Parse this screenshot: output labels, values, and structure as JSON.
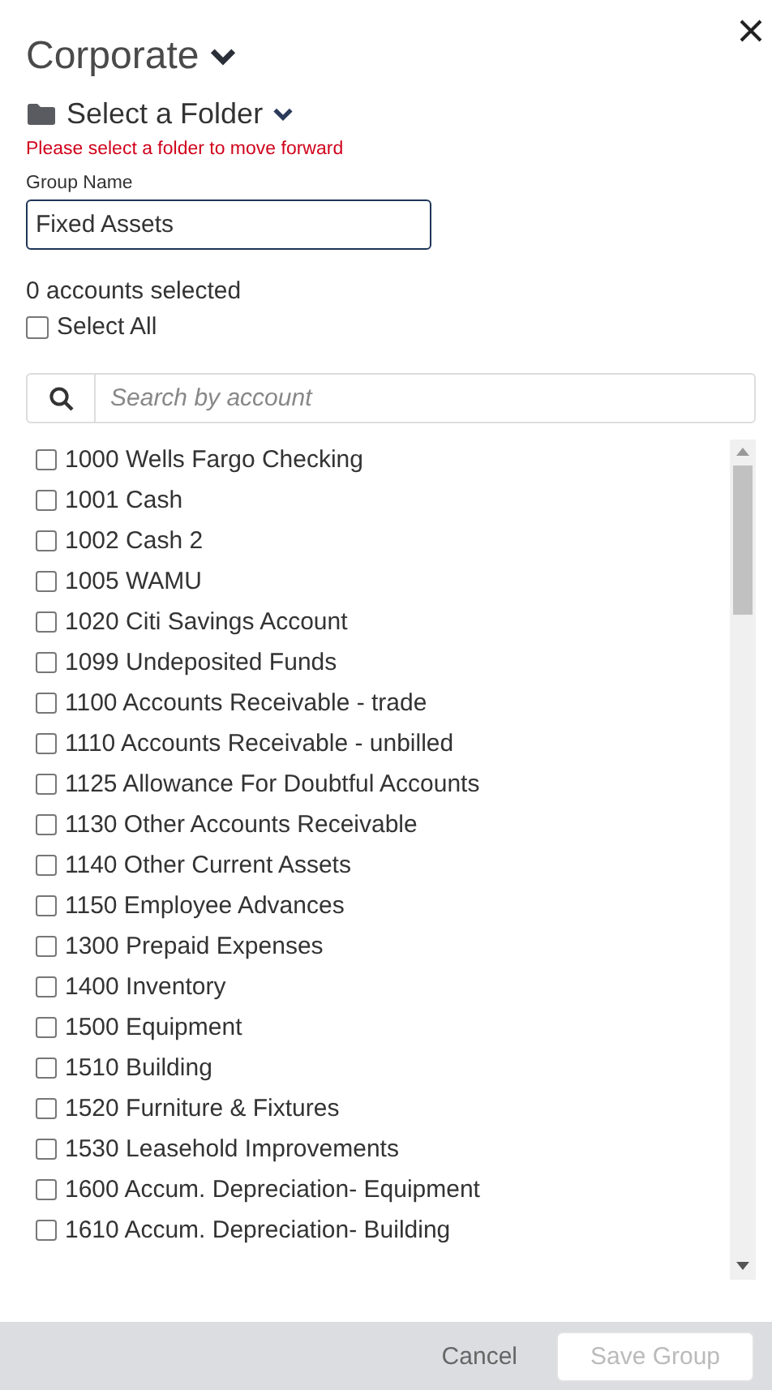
{
  "title": "Corporate",
  "folder": {
    "label": "Select a Folder"
  },
  "error": "Please select a folder to move forward",
  "group_name": {
    "label": "Group Name",
    "value": "Fixed Assets"
  },
  "selected_count": "0 accounts selected",
  "select_all": {
    "label": "Select All",
    "checked": false
  },
  "search": {
    "placeholder": "Search by account"
  },
  "accounts": [
    {
      "label": "1000 Wells Fargo Checking",
      "checked": false
    },
    {
      "label": "1001 Cash",
      "checked": false
    },
    {
      "label": "1002 Cash 2",
      "checked": false
    },
    {
      "label": "1005 WAMU",
      "checked": false
    },
    {
      "label": "1020 Citi Savings Account",
      "checked": false
    },
    {
      "label": "1099 Undeposited Funds",
      "checked": false
    },
    {
      "label": "1100 Accounts Receivable - trade",
      "checked": false
    },
    {
      "label": "1110 Accounts Receivable - unbilled",
      "checked": false
    },
    {
      "label": "1125 Allowance For Doubtful Accounts",
      "checked": false
    },
    {
      "label": "1130 Other Accounts Receivable",
      "checked": false
    },
    {
      "label": "1140 Other Current Assets",
      "checked": false
    },
    {
      "label": "1150 Employee Advances",
      "checked": false
    },
    {
      "label": "1300 Prepaid Expenses",
      "checked": false
    },
    {
      "label": "1400 Inventory",
      "checked": false
    },
    {
      "label": "1500 Equipment",
      "checked": false
    },
    {
      "label": "1510 Building",
      "checked": false
    },
    {
      "label": "1520 Furniture & Fixtures",
      "checked": false
    },
    {
      "label": "1530 Leasehold Improvements",
      "checked": false
    },
    {
      "label": "1600 Accum. Depreciation- Equipment",
      "checked": false
    },
    {
      "label": "1610 Accum. Depreciation- Building",
      "checked": false
    }
  ],
  "footer": {
    "cancel": {
      "label": "Cancel"
    },
    "save": {
      "label": "Save Group",
      "disabled": true
    }
  }
}
